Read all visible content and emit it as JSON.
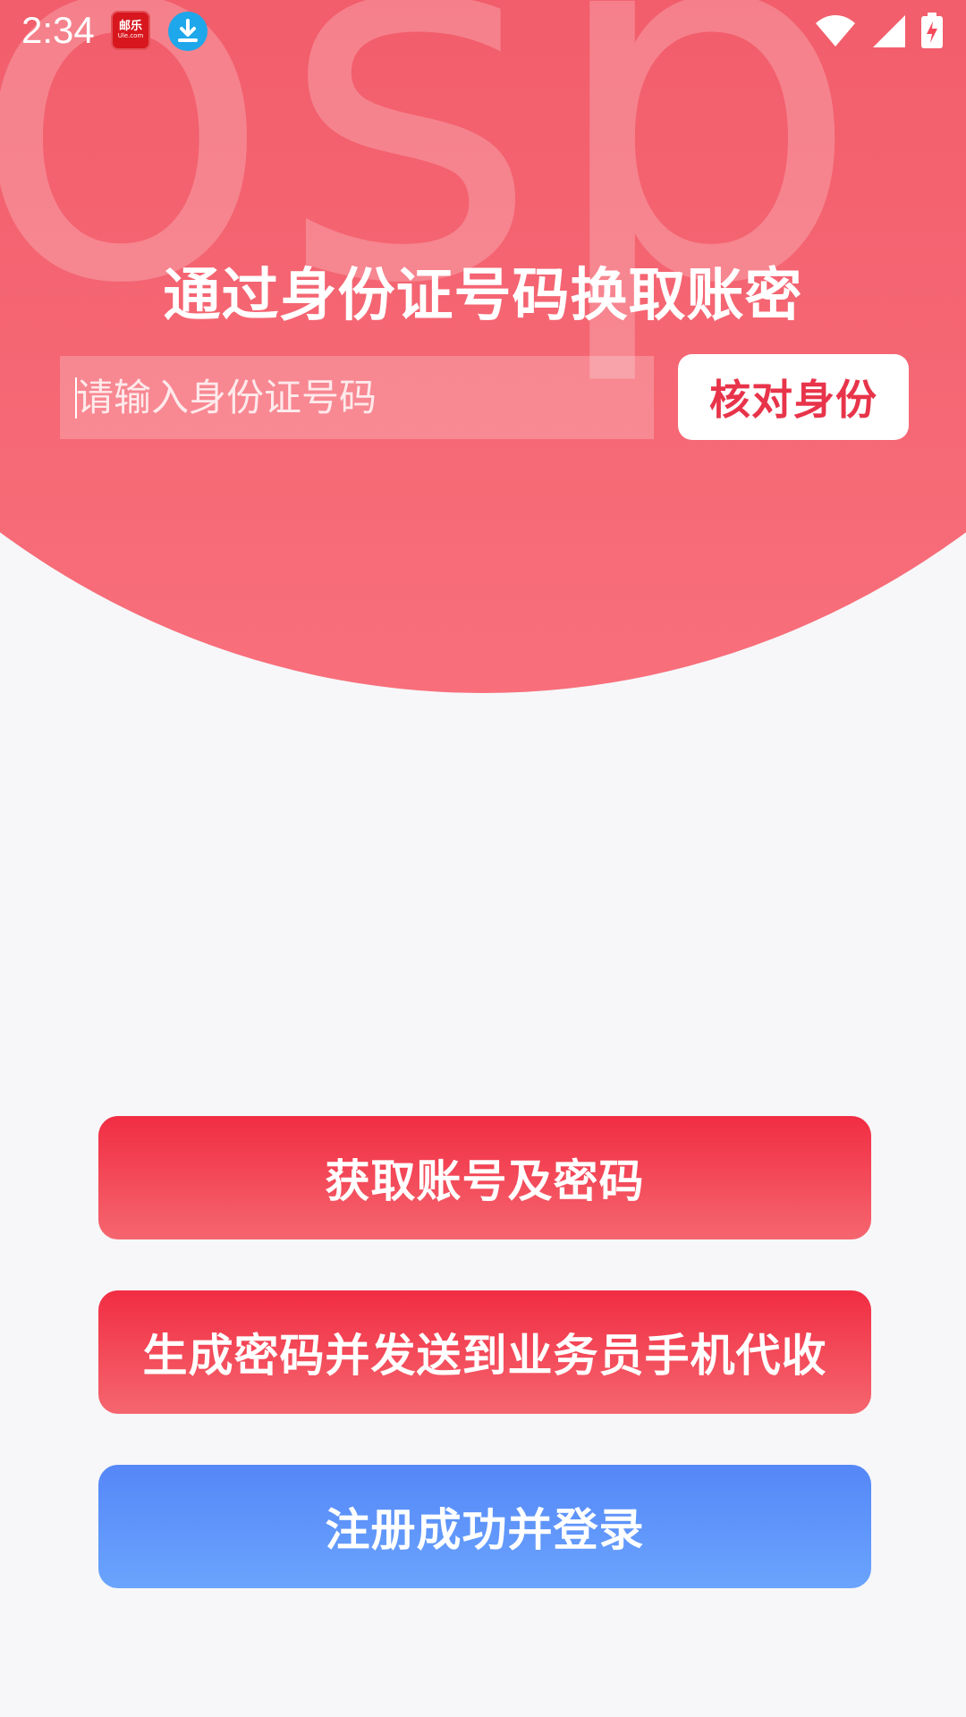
{
  "status_bar": {
    "time": "2:34",
    "app_icon_text": "邮乐",
    "app_icon_subtext": "Ule.com",
    "icons": [
      "download-icon",
      "wifi-icon",
      "signal-icon",
      "battery-charging-icon"
    ]
  },
  "header": {
    "watermark": "osp",
    "title": "通过身份证号码换取账密"
  },
  "id_form": {
    "input_value": "",
    "input_placeholder": "请输入身份证号码",
    "verify_label": "核对身份"
  },
  "actions": {
    "get_account_label": "获取账号及密码",
    "generate_password_label": "生成密码并发送到业务员手机代收",
    "register_login_label": "注册成功并登录"
  },
  "colors": {
    "header_red": "#f44a5c",
    "button_red": "#f12d43",
    "button_blue": "#5587f8",
    "background": "#f7f7f9",
    "verify_text": "#e8344a"
  }
}
